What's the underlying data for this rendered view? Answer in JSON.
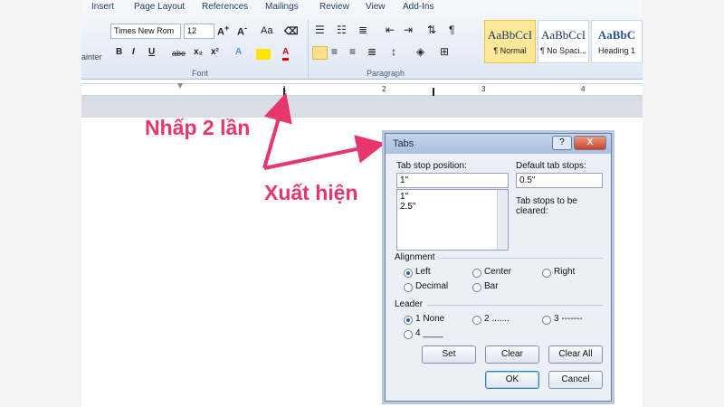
{
  "ribbon": {
    "tabs": [
      "Insert",
      "Page Layout",
      "References",
      "Mailings",
      "Review",
      "View",
      "Add-Ins"
    ],
    "font_name": "Times New Rom",
    "font_size": "12",
    "format_buttons": [
      "B",
      "I",
      "U",
      "abe",
      "x₂",
      "x²",
      "A",
      "A"
    ],
    "left_clip_label": "ainter",
    "groups": {
      "font": "Font",
      "paragraph": "Paragraph"
    },
    "styles": [
      {
        "sample": "AaBbCcI",
        "name": "¶ Normal"
      },
      {
        "sample": "AaBbCcI",
        "name": "¶ No Spaci..."
      },
      {
        "sample": "AaBbC",
        "name": "Heading 1"
      }
    ],
    "ruler_numbers": [
      "1",
      "2",
      "3",
      "4"
    ]
  },
  "annotations": {
    "double_click": "Nhấp 2 lần",
    "appears": "Xuất hiện",
    "color": "#e8356b"
  },
  "dialog": {
    "title": "Tabs",
    "help_button": "?",
    "close_button": "X",
    "tab_stop_label": "Tab stop position:",
    "tab_stop_value": "1\"",
    "tab_stop_list": [
      "1\"",
      "2.5\""
    ],
    "default_tab_label": "Default tab stops:",
    "default_tab_value": "0.5\"",
    "cleared_label": "Tab stops to be cleared:",
    "alignment_label": "Alignment",
    "alignment_options": [
      {
        "label": "Left",
        "selected": true
      },
      {
        "label": "Center",
        "selected": false
      },
      {
        "label": "Right",
        "selected": false
      },
      {
        "label": "Decimal",
        "selected": false
      },
      {
        "label": "Bar",
        "selected": false
      }
    ],
    "leader_label": "Leader",
    "leader_options": [
      {
        "label": "1 None",
        "selected": true
      },
      {
        "label": "2 .......",
        "selected": false
      },
      {
        "label": "3 -------",
        "selected": false
      },
      {
        "label": "4 ____",
        "selected": false
      }
    ],
    "buttons": {
      "set": "Set",
      "clear": "Clear",
      "clear_all": "Clear All",
      "ok": "OK",
      "cancel": "Cancel"
    }
  }
}
